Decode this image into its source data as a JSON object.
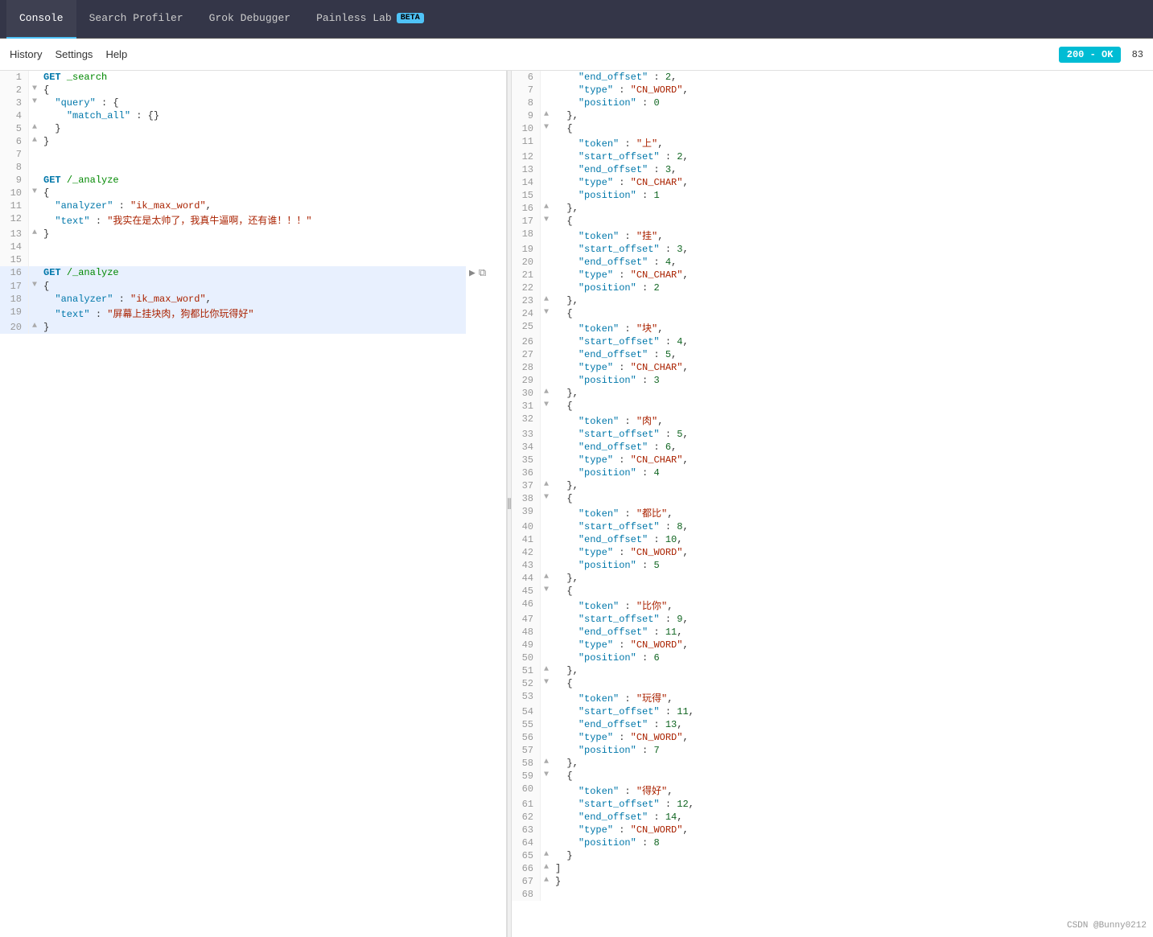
{
  "tabs": [
    {
      "label": "Console",
      "active": true
    },
    {
      "label": "Search Profiler",
      "active": false
    },
    {
      "label": "Grok Debugger",
      "active": false
    },
    {
      "label": "Painless Lab",
      "active": false,
      "beta": true
    }
  ],
  "toolbar": {
    "history_label": "History",
    "settings_label": "Settings",
    "help_label": "Help",
    "status": "200 - OK",
    "status_code": "83"
  },
  "editor": {
    "lines": [
      {
        "num": 1,
        "content": "GET _search",
        "fold": "",
        "highlight": false
      },
      {
        "num": 2,
        "content": "{",
        "fold": "▼",
        "highlight": false
      },
      {
        "num": 3,
        "content": "  \"query\": {",
        "fold": "▼",
        "highlight": false
      },
      {
        "num": 4,
        "content": "    \"match_all\": {}",
        "fold": "",
        "highlight": false
      },
      {
        "num": 5,
        "content": "  }",
        "fold": "▲",
        "highlight": false
      },
      {
        "num": 6,
        "content": "}",
        "fold": "▲",
        "highlight": false
      },
      {
        "num": 7,
        "content": "",
        "fold": "",
        "highlight": false
      },
      {
        "num": 8,
        "content": "",
        "fold": "",
        "highlight": false
      },
      {
        "num": 9,
        "content": "GET /_analyze",
        "fold": "",
        "highlight": false
      },
      {
        "num": 10,
        "content": "{",
        "fold": "▼",
        "highlight": false
      },
      {
        "num": 11,
        "content": "  \"analyzer\": \"ik_max_word\",",
        "fold": "",
        "highlight": false
      },
      {
        "num": 12,
        "content": "  \"text\": \"我实在是太帅了，我真牛逼啊，还有谁！！！\"",
        "fold": "",
        "highlight": false
      },
      {
        "num": 13,
        "content": "}",
        "fold": "▲",
        "highlight": false
      },
      {
        "num": 14,
        "content": "",
        "fold": "",
        "highlight": false
      },
      {
        "num": 15,
        "content": "",
        "fold": "",
        "highlight": false
      },
      {
        "num": 16,
        "content": "GET /_analyze",
        "fold": "",
        "highlight": true,
        "has_actions": true
      },
      {
        "num": 17,
        "content": "{",
        "fold": "▼",
        "highlight": true
      },
      {
        "num": 18,
        "content": "  \"analyzer\": \"ik_max_word\",",
        "fold": "",
        "highlight": true
      },
      {
        "num": 19,
        "content": "  \"text\": \"屏幕上挂块肉，狗都比你玩得好\"",
        "fold": "",
        "highlight": true
      },
      {
        "num": 20,
        "content": "}",
        "fold": "▲",
        "highlight": true
      }
    ]
  },
  "output": {
    "lines": [
      {
        "num": 6,
        "fold": "",
        "content": "    \"end_offset\" : 2,"
      },
      {
        "num": 7,
        "fold": "",
        "content": "    \"type\" : \"CN_WORD\","
      },
      {
        "num": 8,
        "fold": "",
        "content": "    \"position\" : 0"
      },
      {
        "num": 9,
        "fold": "▲",
        "content": "  },"
      },
      {
        "num": 10,
        "fold": "▼",
        "content": "  {"
      },
      {
        "num": 11,
        "fold": "",
        "content": "    \"token\" : \"上\","
      },
      {
        "num": 12,
        "fold": "",
        "content": "    \"start_offset\" : 2,"
      },
      {
        "num": 13,
        "fold": "",
        "content": "    \"end_offset\" : 3,"
      },
      {
        "num": 14,
        "fold": "",
        "content": "    \"type\" : \"CN_CHAR\","
      },
      {
        "num": 15,
        "fold": "",
        "content": "    \"position\" : 1"
      },
      {
        "num": 16,
        "fold": "▲",
        "content": "  },"
      },
      {
        "num": 17,
        "fold": "▼",
        "content": "  {"
      },
      {
        "num": 18,
        "fold": "",
        "content": "    \"token\" : \"挂\","
      },
      {
        "num": 19,
        "fold": "",
        "content": "    \"start_offset\" : 3,"
      },
      {
        "num": 20,
        "fold": "",
        "content": "    \"end_offset\" : 4,"
      },
      {
        "num": 21,
        "fold": "",
        "content": "    \"type\" : \"CN_CHAR\","
      },
      {
        "num": 22,
        "fold": "",
        "content": "    \"position\" : 2"
      },
      {
        "num": 23,
        "fold": "▲",
        "content": "  },"
      },
      {
        "num": 24,
        "fold": "▼",
        "content": "  {"
      },
      {
        "num": 25,
        "fold": "",
        "content": "    \"token\" : \"块\","
      },
      {
        "num": 26,
        "fold": "",
        "content": "    \"start_offset\" : 4,"
      },
      {
        "num": 27,
        "fold": "",
        "content": "    \"end_offset\" : 5,"
      },
      {
        "num": 28,
        "fold": "",
        "content": "    \"type\" : \"CN_CHAR\","
      },
      {
        "num": 29,
        "fold": "",
        "content": "    \"position\" : 3"
      },
      {
        "num": 30,
        "fold": "▲",
        "content": "  },"
      },
      {
        "num": 31,
        "fold": "▼",
        "content": "  {"
      },
      {
        "num": 32,
        "fold": "",
        "content": "    \"token\" : \"肉\","
      },
      {
        "num": 33,
        "fold": "",
        "content": "    \"start_offset\" : 5,"
      },
      {
        "num": 34,
        "fold": "",
        "content": "    \"end_offset\" : 6,"
      },
      {
        "num": 35,
        "fold": "",
        "content": "    \"type\" : \"CN_CHAR\","
      },
      {
        "num": 36,
        "fold": "",
        "content": "    \"position\" : 4"
      },
      {
        "num": 37,
        "fold": "▲",
        "content": "  },"
      },
      {
        "num": 38,
        "fold": "▼",
        "content": "  {"
      },
      {
        "num": 39,
        "fold": "",
        "content": "    \"token\" : \"都比\","
      },
      {
        "num": 40,
        "fold": "",
        "content": "    \"start_offset\" : 8,"
      },
      {
        "num": 41,
        "fold": "",
        "content": "    \"end_offset\" : 10,"
      },
      {
        "num": 42,
        "fold": "",
        "content": "    \"type\" : \"CN_WORD\","
      },
      {
        "num": 43,
        "fold": "",
        "content": "    \"position\" : 5"
      },
      {
        "num": 44,
        "fold": "▲",
        "content": "  },"
      },
      {
        "num": 45,
        "fold": "▼",
        "content": "  {"
      },
      {
        "num": 46,
        "fold": "",
        "content": "    \"token\" : \"比你\","
      },
      {
        "num": 47,
        "fold": "",
        "content": "    \"start_offset\" : 9,"
      },
      {
        "num": 48,
        "fold": "",
        "content": "    \"end_offset\" : 11,"
      },
      {
        "num": 49,
        "fold": "",
        "content": "    \"type\" : \"CN_WORD\","
      },
      {
        "num": 50,
        "fold": "",
        "content": "    \"position\" : 6"
      },
      {
        "num": 51,
        "fold": "▲",
        "content": "  },"
      },
      {
        "num": 52,
        "fold": "▼",
        "content": "  {"
      },
      {
        "num": 53,
        "fold": "",
        "content": "    \"token\" : \"玩得\","
      },
      {
        "num": 54,
        "fold": "",
        "content": "    \"start_offset\" : 11,"
      },
      {
        "num": 55,
        "fold": "",
        "content": "    \"end_offset\" : 13,"
      },
      {
        "num": 56,
        "fold": "",
        "content": "    \"type\" : \"CN_WORD\","
      },
      {
        "num": 57,
        "fold": "",
        "content": "    \"position\" : 7"
      },
      {
        "num": 58,
        "fold": "▲",
        "content": "  },"
      },
      {
        "num": 59,
        "fold": "▼",
        "content": "  {"
      },
      {
        "num": 60,
        "fold": "",
        "content": "    \"token\" : \"得好\","
      },
      {
        "num": 61,
        "fold": "",
        "content": "    \"start_offset\" : 12,"
      },
      {
        "num": 62,
        "fold": "",
        "content": "    \"end_offset\" : 14,"
      },
      {
        "num": 63,
        "fold": "",
        "content": "    \"type\" : \"CN_WORD\","
      },
      {
        "num": 64,
        "fold": "",
        "content": "    \"position\" : 8"
      },
      {
        "num": 65,
        "fold": "▲",
        "content": "  }"
      },
      {
        "num": 66,
        "fold": "▲",
        "content": "]"
      },
      {
        "num": 67,
        "fold": "▲",
        "content": "}"
      },
      {
        "num": 68,
        "fold": "",
        "content": ""
      }
    ]
  },
  "watermark": "CSDN @Bunny0212"
}
